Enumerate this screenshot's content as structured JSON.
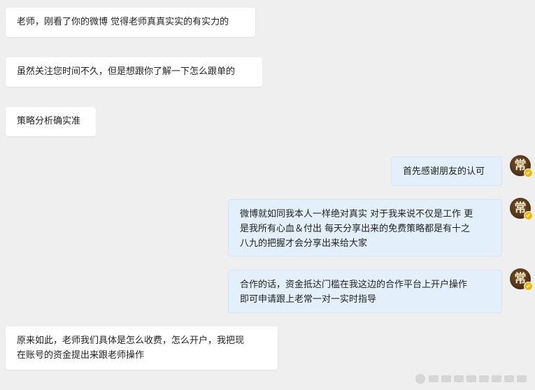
{
  "messages": [
    {
      "side": "left",
      "text": "老师，刚看了你的微博 觉得老师真真实实的有实力的"
    },
    {
      "side": "left",
      "text": "虽然关注您时间不久，但是想跟你了解一下怎么跟单的"
    },
    {
      "side": "left",
      "text": "策略分析确实准"
    },
    {
      "side": "right",
      "text": "首先感谢朋友的认可",
      "avatar_glyph": "常"
    },
    {
      "side": "right",
      "lines": [
        "微博就如同我本人一样绝对真实 对于我来说不仅是工作 更",
        "是我所有心血＆付出 每天分享出来的免费策略都是有十之",
        "八九的把握才会分享出来给大家"
      ],
      "avatar_glyph": "常"
    },
    {
      "side": "right",
      "lines": [
        "合作的话，资金抵达门槛在我这边的合作平台上开户操作",
        "即可申请跟上老常一对一实时指导"
      ],
      "avatar_glyph": "常"
    },
    {
      "side": "left",
      "lines": [
        "原来如此，老师我们具体是怎么收费，怎么开户，我把现",
        "在账号的资金提出来跟老师操作"
      ]
    }
  ],
  "colors": {
    "background": "#efefef",
    "left_bubble": "#ffffff",
    "right_bubble": "#e3f0fb",
    "verified_badge": "#f5b400"
  },
  "icons": {
    "avatar": "avatar-icon",
    "verified": "verified-badge-icon",
    "watermark": "watermark-logo-icon"
  }
}
